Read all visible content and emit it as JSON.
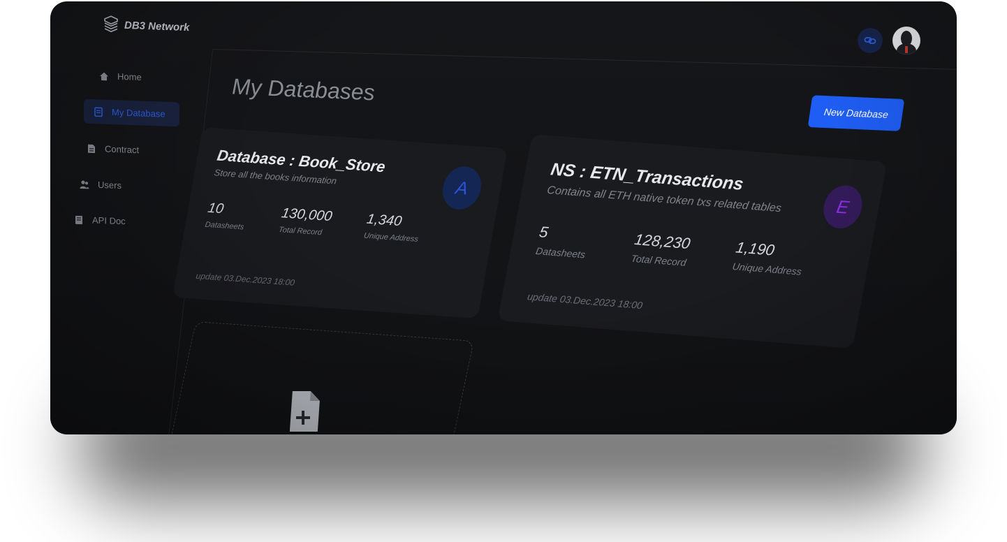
{
  "brand": {
    "name": "DB3 Network",
    "logo_icon": "stack-icon"
  },
  "header": {
    "link_icon": "link-icon",
    "avatar_icon": "user-avatar"
  },
  "sidebar": {
    "items": [
      {
        "label": "Home",
        "icon": "home-icon",
        "active": false
      },
      {
        "label": "My Database",
        "icon": "database-icon",
        "active": true
      },
      {
        "label": "Contract",
        "icon": "document-icon",
        "active": false
      },
      {
        "label": "Users",
        "icon": "users-icon",
        "active": false
      },
      {
        "label": "API Doc",
        "icon": "book-icon",
        "active": false
      }
    ]
  },
  "main": {
    "title": "My Databases",
    "new_button": "New Database",
    "cards": [
      {
        "title": "Database : Book_Store",
        "description": "Store all the books information",
        "badge": "A",
        "stats": [
          {
            "value": "10",
            "label": "Datasheets"
          },
          {
            "value": "130,000",
            "label": "Total Record"
          },
          {
            "value": "1,340",
            "label": "Unique Address"
          }
        ],
        "updated": "update 03.Dec.2023 18:00"
      },
      {
        "title": "NS : ETN_Transactions",
        "description": "Contains all ETH native token txs related tables",
        "badge": "E",
        "stats": [
          {
            "value": "5",
            "label": "Datasheets"
          },
          {
            "value": "128,230",
            "label": "Total Record"
          },
          {
            "value": "1,190",
            "label": "Unique Address"
          }
        ],
        "updated": "update 03.Dec.2023 18:00"
      }
    ],
    "add_card_icon": "add-file-icon"
  },
  "colors": {
    "accent": "#1f5ef5",
    "background": "#131417",
    "card": "#1a1b1f",
    "badge_a": "#2b52d9",
    "badge_e": "#8a2fe0"
  }
}
